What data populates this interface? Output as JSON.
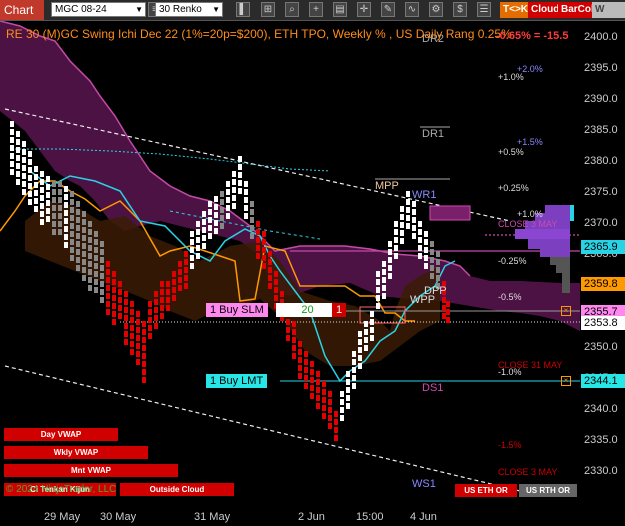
{
  "toolbar": {
    "tab_label": "Chart",
    "instrument": "MGC 08-24",
    "interval": "30 Renko",
    "tick_badge": "T<>K",
    "cloud_label": "Cloud",
    "barcol_label": "BarCol",
    "vwap_label": "W VWA"
  },
  "header": {
    "title": "RE 30 (M)GC Swing Ichi Dec 22 (1%=20p=$200), ETH TPO, Weekly % , US Daily Rang 0.25%",
    "change": "-0.65% = -15.5"
  },
  "yaxis": {
    "ticks": [
      "2400.0",
      "2395.0",
      "2390.0",
      "2385.0",
      "2380.0",
      "2375.0",
      "2370.0",
      "2365.0",
      "2360.0",
      "2355.0",
      "2350.0",
      "2345.0",
      "2340.0",
      "2335.0",
      "2330.0"
    ]
  },
  "xaxis": {
    "ticks": [
      "29 May",
      "30 May",
      "31 May",
      "2 Jun",
      "15:00",
      "4 Jun"
    ]
  },
  "levels": {
    "dr2": "DR2",
    "dr1": "DR1",
    "mpp": "MPP",
    "wr1": "WR1",
    "dpp": "DPP",
    "wpp": "WPP",
    "ds1": "DS1",
    "ws1": "WS1",
    "p20": "+2.0%",
    "p10": "+1.0%",
    "p15": "+1.5%",
    "p05": "+0.5%",
    "p025": "+0.25%",
    "p10b": "+1.0%",
    "close1": "CLOSE 3 MAY",
    "m025": "-0.25%",
    "m05": "-0.5%",
    "close31": "CLOSE 31 MAY",
    "m10": "-1.0%",
    "m15": "-1.5%",
    "close3": "CLOSE 3 MAY"
  },
  "price_tags": {
    "p1": "2365.9",
    "p2": "2359.8",
    "p3": "2355.7",
    "p4": "2353.8",
    "p5": "2344.1"
  },
  "orders": {
    "buy_slm": "1 Buy SLM",
    "buy_slm_price": "20",
    "buy_slm_qty": "1",
    "buy_lmt": "1 Buy LMT"
  },
  "panel_buttons": {
    "day_vwap": "Day VWAP",
    "wkly_vwap": "Wkly VWAP",
    "mnt_vwap": "Mnt VWAP",
    "tenkan_kijun": "Ci Tenkan Kijun",
    "outside_cloud": "Outside Cloud",
    "us_eth_or": "US ETH OR",
    "us_rth_or": "US RTH OR"
  },
  "watermark": "© 2024 NinjaTrader, LLC",
  "colors": {
    "accent": "#c0392b",
    "up": "#ffffff",
    "down": "#e00000",
    "cloud": "#7a1f6a",
    "orange": "#ff9900",
    "cyan": "#29d3e6"
  }
}
